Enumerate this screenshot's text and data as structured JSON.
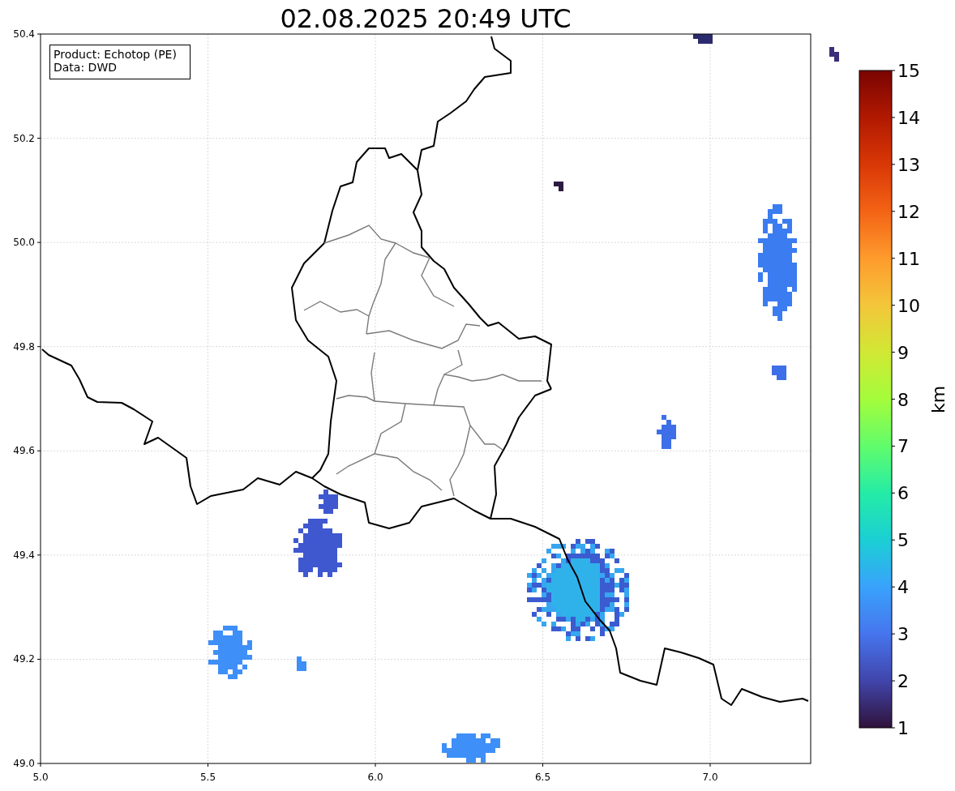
{
  "title": "02.08.2025 20:49 UTC",
  "info_box": [
    "Product: Echotop (PE)",
    "Data: DWD"
  ],
  "map": {
    "xticks": [
      "5.0",
      "5.5",
      "6.0",
      "6.5",
      "7.0"
    ],
    "yticks": [
      "50.4",
      "50.2",
      "50.0",
      "49.8",
      "49.6",
      "49.4",
      "49.2",
      "49.0"
    ]
  },
  "colorbar": {
    "label": "km",
    "ticks": [
      "15",
      "14",
      "13",
      "12",
      "11",
      "10",
      "9",
      "8",
      "7",
      "6",
      "5",
      "4",
      "3",
      "2",
      "1"
    ]
  }
}
